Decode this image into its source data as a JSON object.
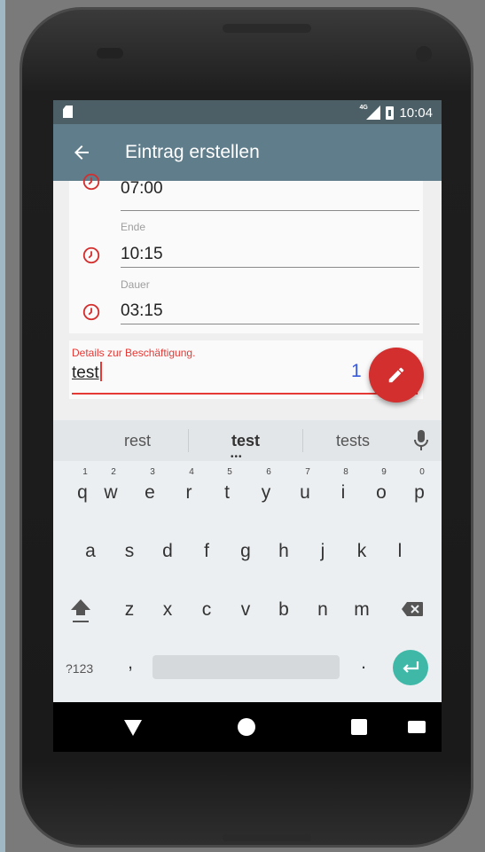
{
  "statusbar": {
    "network": "4G",
    "time": "10:04"
  },
  "appbar": {
    "title": "Eintrag erstellen",
    "back_icon": "arrow-back-icon"
  },
  "form": {
    "start_value": "07:00",
    "end_label": "Ende",
    "end_value": "10:15",
    "duration_label": "Dauer",
    "duration_value": "03:15",
    "details_label": "Details zur Beschäftigung.",
    "details_value": "test",
    "char_counter": "1"
  },
  "fab": {
    "icon": "pencil-icon"
  },
  "keyboard": {
    "suggestions": [
      "rest",
      "test",
      "tests"
    ],
    "row1": [
      "q",
      "w",
      "e",
      "r",
      "t",
      "y",
      "u",
      "i",
      "o",
      "p"
    ],
    "row1_hints": [
      "1",
      "2",
      "3",
      "4",
      "5",
      "6",
      "7",
      "8",
      "9",
      "0"
    ],
    "row2": [
      "a",
      "s",
      "d",
      "f",
      "g",
      "h",
      "j",
      "k",
      "l"
    ],
    "row3": [
      "z",
      "x",
      "c",
      "v",
      "b",
      "n",
      "m"
    ],
    "symbols_key": "?123",
    "comma_key": ",",
    "period_key": "."
  },
  "colors": {
    "appbar": "#607d8b",
    "statusbar": "#4d5f66",
    "accent": "#d32f2f",
    "enter": "#3fb8a8"
  }
}
